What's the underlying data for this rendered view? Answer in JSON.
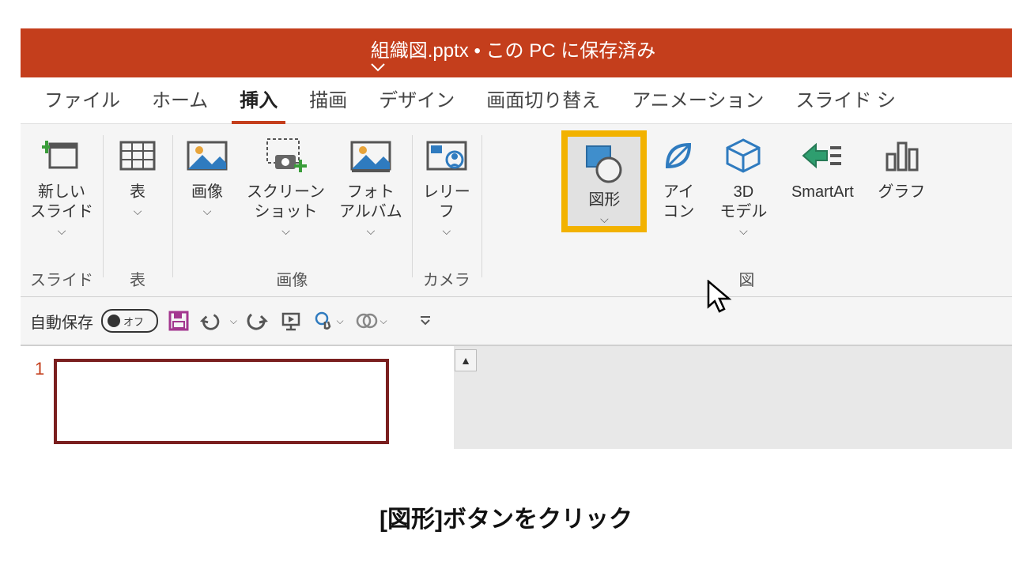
{
  "title": {
    "filename": "組織図.pptx",
    "separator": " • ",
    "status": "この PC に保存済み"
  },
  "tabs": {
    "file": "ファイル",
    "home": "ホーム",
    "insert": "挿入",
    "draw": "描画",
    "design": "デザイン",
    "transitions": "画面切り替え",
    "animations": "アニメーション",
    "slideshow": "スライド シ"
  },
  "ribbon": {
    "slide": {
      "new_slide": "新しい\nスライド",
      "group": "スライド"
    },
    "table": {
      "table": "表",
      "group": "表"
    },
    "images": {
      "pictures": "画像",
      "screenshot": "スクリーン\nショット",
      "album": "フォト\nアルバム",
      "group": "画像"
    },
    "camera": {
      "relief": "レリー\nフ",
      "group": "カメラ"
    },
    "illust": {
      "shapes": "図形",
      "icons": "アイ\nコン",
      "models": "3D\nモデル",
      "smartart": "SmartArt",
      "chart": "グラフ",
      "group": "図"
    }
  },
  "qat": {
    "autosave": "自動保存",
    "off": "オフ"
  },
  "thumb": {
    "num": "1"
  },
  "caption": "[図形]ボタンをクリック"
}
